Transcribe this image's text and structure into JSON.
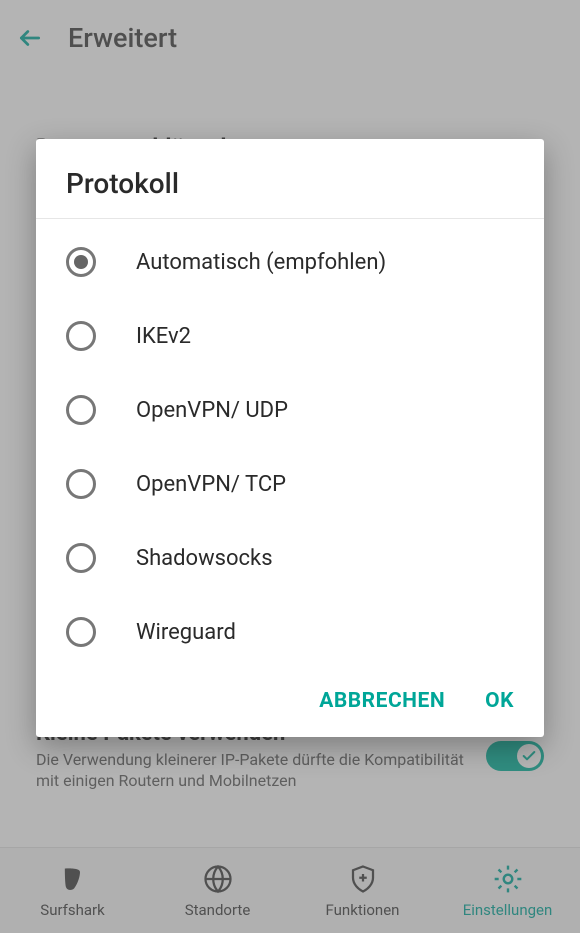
{
  "appBar": {
    "title": "Erweitert"
  },
  "background": {
    "sectionHeading": "Datenverschlüsselung",
    "smallPackets": {
      "title": "Kleine Pakete verwenden",
      "description": "Die Verwendung kleinerer IP-Pakete dürfte die Kompatibilität mit einigen Routern und Mobilnetzen"
    }
  },
  "dialog": {
    "title": "Protokoll",
    "options": [
      {
        "label": "Automatisch (empfohlen)",
        "selected": true
      },
      {
        "label": "IKEv2",
        "selected": false
      },
      {
        "label": "OpenVPN/ UDP",
        "selected": false
      },
      {
        "label": "OpenVPN/ TCP",
        "selected": false
      },
      {
        "label": "Shadowsocks",
        "selected": false
      },
      {
        "label": "Wireguard",
        "selected": false
      }
    ],
    "actions": {
      "cancel": "ABBRECHEN",
      "ok": "OK"
    }
  },
  "bottomNav": {
    "items": [
      {
        "label": "Surfshark",
        "active": false
      },
      {
        "label": "Standorte",
        "active": false
      },
      {
        "label": "Funktionen",
        "active": false
      },
      {
        "label": "Einstellungen",
        "active": true
      }
    ]
  }
}
